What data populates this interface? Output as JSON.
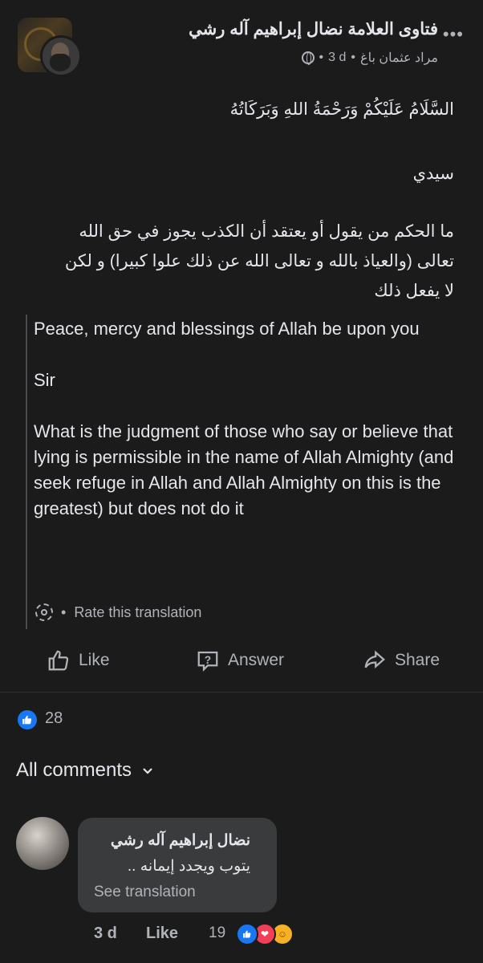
{
  "header": {
    "group_name": "فتاوى العلامة نضال إبراهيم آله رشي",
    "author": "مراد عثمان باغ",
    "time": "3 d",
    "more_icon": "more-horizontal-icon",
    "privacy_icon": "globe-icon"
  },
  "post": {
    "greeting": "السَّلَامُ عَلَيْكُمْ وَرَحْمَةُ اللهِ وَبَرَكَاتُهُ",
    "salutation": "سيدي",
    "question_lines": [
      "ما الحكم من يقول  أو يعتقد أن الكذب يجوز في حق الله",
      "تعالى (والعياذ بالله و تعالى الله عن ذلك علوا كبيرا) و لكن",
      "لا يفعل ذلك"
    ]
  },
  "translation": {
    "greeting": "Peace, mercy and blessings of Allah be upon you",
    "salutation": "Sir",
    "question": "What is the judgment of those who say or believe that lying is permissible in the name of Allah Almighty (and seek refuge in Allah and Allah Almighty on this is the greatest) but does not do it",
    "separator": "•",
    "rate_label": "Rate this translation"
  },
  "actions": {
    "like": "Like",
    "answer": "Answer",
    "share": "Share"
  },
  "reactions": {
    "count": "28"
  },
  "comments_filter": "All comments",
  "comment": {
    "name": "نضال إبراهيم آله رشي",
    "text": "يتوب ويجدد إيمانه ..",
    "see_translation": "See translation",
    "time": "3 d",
    "like": "Like",
    "reaction_count": "19"
  },
  "colors": {
    "background": "#1b1b1c",
    "bubble": "#3a3b3c",
    "like_blue": "#1877f2",
    "love_red": "#f33e58",
    "care_yellow": "#f7b125"
  }
}
